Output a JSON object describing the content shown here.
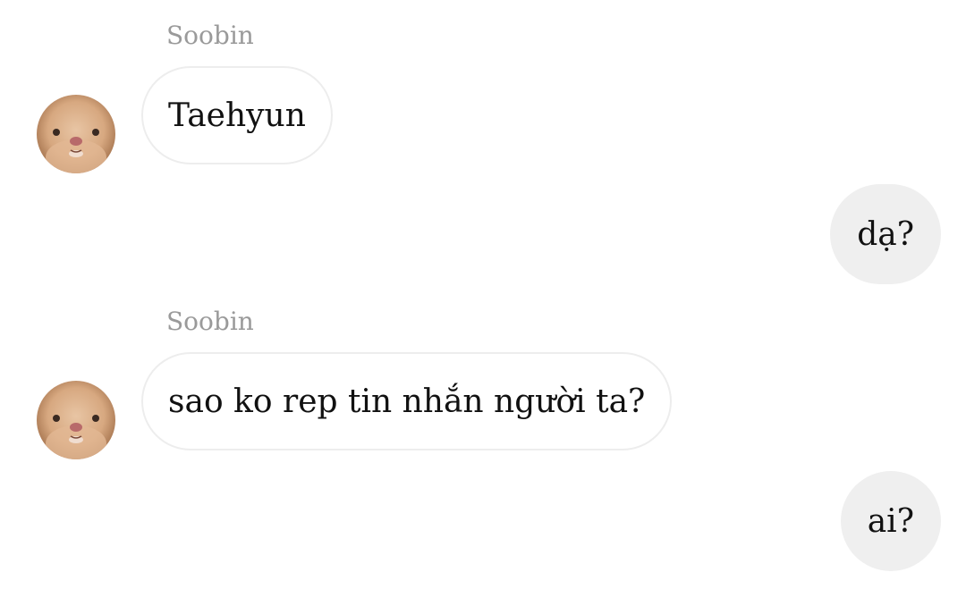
{
  "messages": [
    {
      "direction": "incoming",
      "sender": "Soobin",
      "text": "Taehyun",
      "avatar_icon": "hamster-avatar"
    },
    {
      "direction": "outgoing",
      "text": "dạ?"
    },
    {
      "direction": "incoming",
      "sender": "Soobin",
      "text": "sao ko rep tin nhắn người ta?",
      "avatar_icon": "hamster-avatar"
    },
    {
      "direction": "outgoing",
      "text": "ai?"
    }
  ],
  "colors": {
    "background": "#ffffff",
    "incoming_bubble_border": "#ededed",
    "outgoing_bubble_bg": "#efefef",
    "sender_name": "#9a9a9a",
    "text": "#111111"
  }
}
